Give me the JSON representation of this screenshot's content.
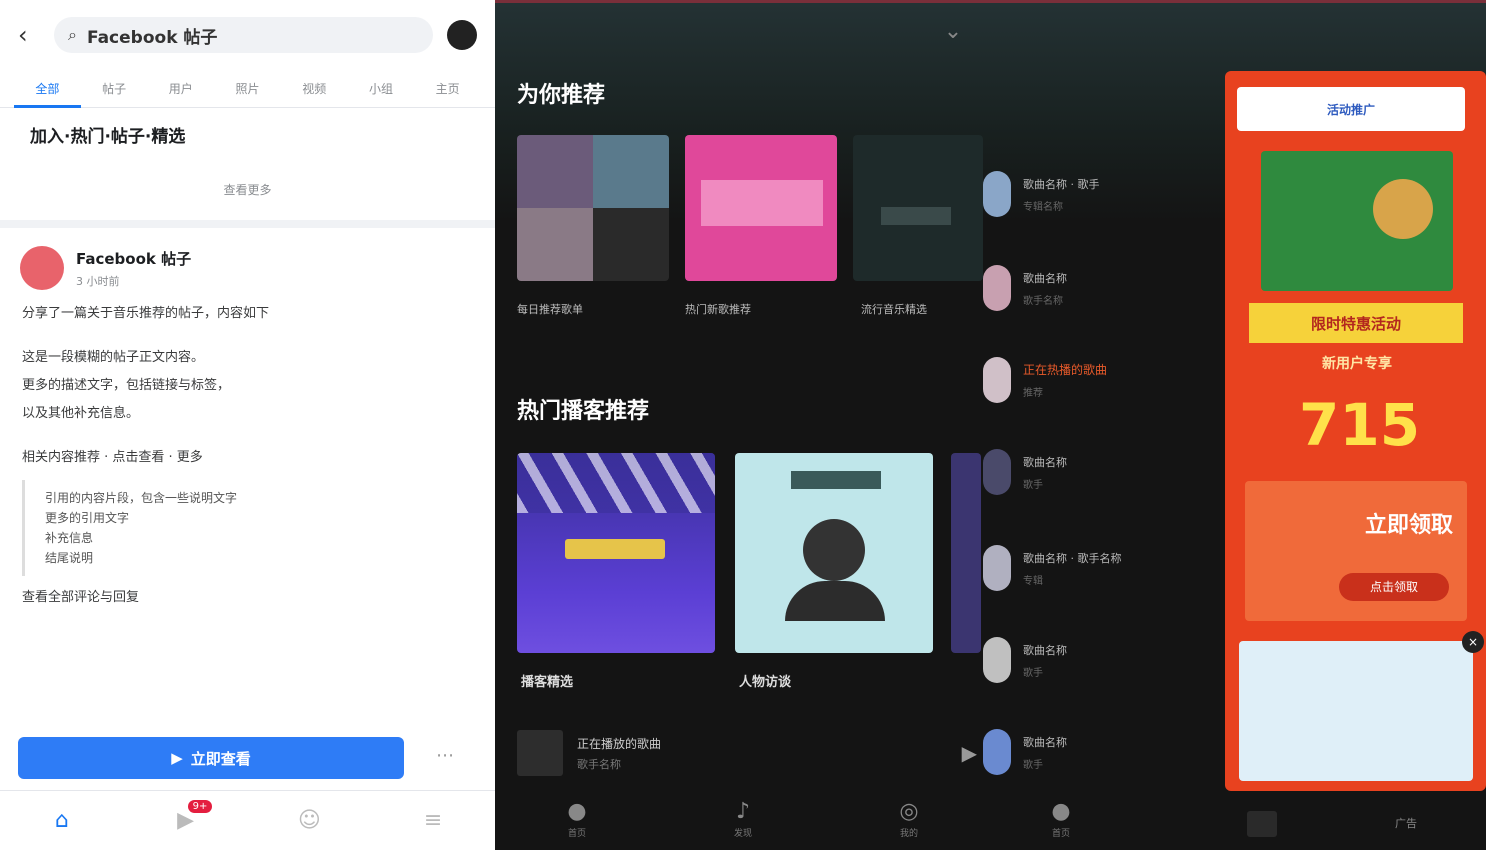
{
  "left": {
    "search_query": "Facebook 帖子",
    "tabs": [
      "全部",
      "帖子",
      "用户",
      "照片",
      "视频",
      "小组",
      "主页"
    ],
    "headline": "加入·热门·帖子·精选",
    "see_more": "查看更多",
    "post": {
      "author": "Facebook 帖子",
      "time": "3 小时前",
      "paragraphs": [
        "分享了一篇关于音乐推荐的帖子，内容如下",
        "这是一段模糊的帖子正文内容。",
        "更多的描述文字，包括链接与标签，",
        "以及其他补充信息。"
      ],
      "line_before_quote": "相关内容推荐 · 点击查看 · 更多",
      "quote_lines": [
        "引用的内容片段，包含一些说明文字",
        "更多的引用文字",
        "补充信息",
        "结尾说明"
      ],
      "after_quote": "查看全部评论与回复"
    },
    "cta_label": "立即查看",
    "cta_side": "⋯",
    "nav": [
      "⌂",
      "▶",
      "☺",
      "≡"
    ],
    "nav_badge": "9+"
  },
  "right": {
    "section1_title": "为你推荐",
    "section2_title": "热门播客推荐",
    "card_labels": [
      "每日推荐歌单",
      "热门新歌推荐",
      "流行音乐精选"
    ],
    "card2_labels": [
      "播客精选",
      "人物访谈"
    ],
    "list": [
      {
        "title": "歌曲名称 · 歌手",
        "sub": "专辑名称"
      },
      {
        "title": "歌曲名称",
        "sub": "歌手名称"
      },
      {
        "title": "正在热播的歌曲",
        "sub": "推荐"
      },
      {
        "title": "歌曲名称",
        "sub": "歌手"
      },
      {
        "title": "歌曲名称 · 歌手名称",
        "sub": "专辑"
      },
      {
        "title": "歌曲名称",
        "sub": "歌手"
      },
      {
        "title": "歌曲名称",
        "sub": "歌手"
      }
    ],
    "now_playing": {
      "title": "正在播放的歌曲",
      "sub": "歌手名称",
      "ctrl": "▶"
    },
    "nav": [
      {
        "icon": "●",
        "label": "首页"
      },
      {
        "icon": "♪",
        "label": "发现"
      },
      {
        "icon": "◎",
        "label": "我的"
      },
      {
        "icon": "●",
        "label": "首页"
      }
    ],
    "top_icon": "⌄"
  },
  "ad": {
    "top_label": "活动推广",
    "banner": "限时特惠活动",
    "line": "新用户专享",
    "big_number": "715",
    "mid_text": "立即领取",
    "mid_button": "点击领取",
    "close": "×",
    "footer_text": "广告"
  }
}
